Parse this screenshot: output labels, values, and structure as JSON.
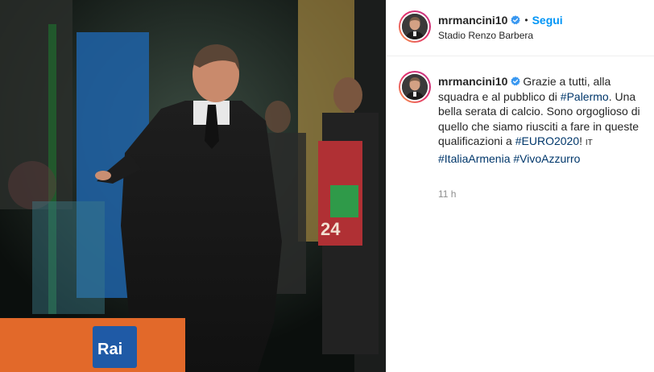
{
  "post": {
    "username": "mrmancini10",
    "verified": true,
    "separator": "•",
    "follow_label": "Segui",
    "location": "Stadio Renzo Barbera"
  },
  "caption": {
    "username": "mrmancini10",
    "text_1": "Grazie a tutti, alla squadra e al pubblico di ",
    "tag_palermo": "#Palermo",
    "text_2": ". Una bella serata di calcio. Sono orgoglioso di quello che siamo riusciti a fare in queste qualificazioni a ",
    "tag_euro": "#EURO2020",
    "text_3": "! ",
    "flag_emoji": "IT",
    "text_4": " ",
    "tag_italia": "#ItaliaArmenia",
    "text_5": " ",
    "tag_vivo": "#VivoAzzurro",
    "time": "11 h"
  },
  "photo": {
    "board_text": "Rai",
    "bib_number": "24"
  },
  "colors": {
    "accent": "#0095f6",
    "hashtag": "#00376b",
    "verified": "#3897f0"
  },
  "icons": {
    "verified": "verified-badge-icon",
    "avatar": "profile-avatar"
  }
}
